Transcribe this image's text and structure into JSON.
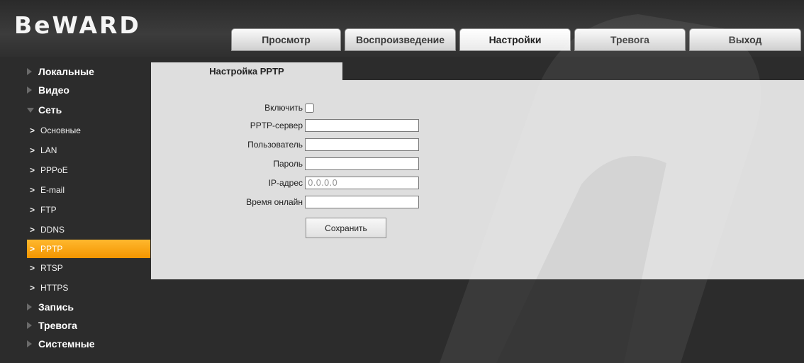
{
  "brand": {
    "logo_text": "BeWARD"
  },
  "tabs": [
    {
      "label": "Просмотр"
    },
    {
      "label": "Воспроизведение"
    },
    {
      "label": "Настройки",
      "active": true
    },
    {
      "label": "Тревога"
    },
    {
      "label": "Выход"
    }
  ],
  "sidebar": {
    "local": "Локальные",
    "video": "Видео",
    "network": "Сеть",
    "sub": {
      "basic": "Основные",
      "lan": "LAN",
      "pppoe": "PPPoE",
      "email": "E-mail",
      "ftp": "FTP",
      "ddns": "DDNS",
      "pptp": "PPTP",
      "rtsp": "RTSP",
      "https": "HTTPS"
    },
    "record": "Запись",
    "alarm": "Тревога",
    "system": "Системные",
    "active_item": "PPTP"
  },
  "panel": {
    "title": "Настройка PPTP",
    "enable_label": "Включить",
    "enable_checked": false,
    "server_label": "PPTP-сервер",
    "server_value": "",
    "user_label": "Пользователь",
    "user_value": "",
    "password_label": "Пароль",
    "password_value": "",
    "ip_label": "IP-адрес",
    "ip_value": "0.0.0.0",
    "online_label": "Время онлайн",
    "online_value": "",
    "save_label": "Сохранить"
  },
  "colors": {
    "accent": "#f39500",
    "background": "#2c2c2c",
    "panel": "#dedede"
  }
}
